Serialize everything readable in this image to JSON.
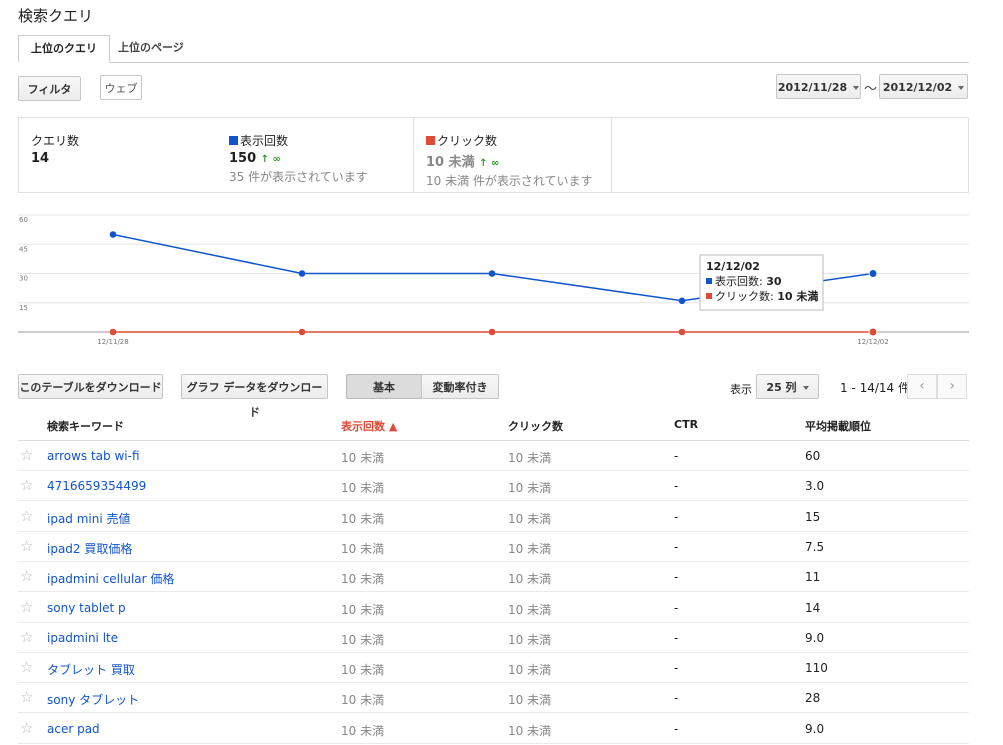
{
  "page_title": "検索クエリ",
  "tabs": [
    {
      "label": "上位のクエリ",
      "active": true
    },
    {
      "label": "上位のページ",
      "active": false
    }
  ],
  "filter_button": "フィルタ",
  "web_filter": "ウェブ",
  "date_range": {
    "start": "2012/11/28",
    "separator": "〜",
    "end": "2012/12/02"
  },
  "summary": {
    "queries": {
      "label": "クエリ数",
      "value": "14"
    },
    "impressions": {
      "label": "表示回数",
      "value": "150",
      "change": "↑ ∞",
      "sub": "35 件が表示されています",
      "color": "#1155cc"
    },
    "clicks": {
      "label": "クリック数",
      "value": "10 未満",
      "change": "↑ ∞",
      "sub": "10 未満 件が表示されています",
      "color": "#dd4b39"
    }
  },
  "chart_data": {
    "type": "line",
    "x": [
      "12/11/28",
      "12/11/29",
      "12/11/30",
      "12/12/01",
      "12/12/02"
    ],
    "x_tick_labels": [
      "12/11/28",
      "12/12/02"
    ],
    "ylim": [
      0,
      60
    ],
    "yticks": [
      15,
      30,
      45,
      60
    ],
    "grid": true,
    "series": [
      {
        "name": "表示回数",
        "color": "#1155cc",
        "values": [
          50,
          30,
          30,
          16,
          30
        ]
      },
      {
        "name": "クリック数",
        "color": "#dd4b39",
        "values": [
          0,
          0,
          0,
          0,
          0
        ]
      }
    ],
    "tooltip": {
      "date": "12/12/02",
      "line1_label": "表示回数: ",
      "line1_value": "30",
      "line2_label": "クリック数: ",
      "line2_value": "10 未満"
    }
  },
  "toolbar": {
    "download_table": "このテーブルをダウンロード",
    "download_chart": "グラフ データをダウンロード",
    "view_basic": "基本",
    "view_change": "変動率付き",
    "show_label": "表示",
    "rows_select": "25 列",
    "pagination": "1 - 14/14 件",
    "prev_icon": "‹",
    "next_icon": "›"
  },
  "table": {
    "headers": [
      "検索キーワード",
      "表示回数 ▲",
      "クリック数",
      "CTR",
      "平均掲載順位"
    ],
    "rows": [
      [
        "arrows tab wi-fi",
        "10 未満",
        "10 未満",
        "-",
        "60"
      ],
      [
        "4716659354499",
        "10 未満",
        "10 未満",
        "-",
        "3.0"
      ],
      [
        "ipad mini 売値",
        "10 未満",
        "10 未満",
        "-",
        "15"
      ],
      [
        "ipad2 買取価格",
        "10 未満",
        "10 未満",
        "-",
        "7.5"
      ],
      [
        "ipadmini cellular 価格",
        "10 未満",
        "10 未満",
        "-",
        "11"
      ],
      [
        "sony tablet p",
        "10 未満",
        "10 未満",
        "-",
        "14"
      ],
      [
        "ipadmini lte",
        "10 未満",
        "10 未満",
        "-",
        "9.0"
      ],
      [
        "タブレット 買取",
        "10 未満",
        "10 未満",
        "-",
        "110"
      ],
      [
        "sony タブレット",
        "10 未満",
        "10 未満",
        "-",
        "28"
      ],
      [
        "acer pad",
        "10 未満",
        "10 未満",
        "-",
        "9.0"
      ]
    ]
  }
}
